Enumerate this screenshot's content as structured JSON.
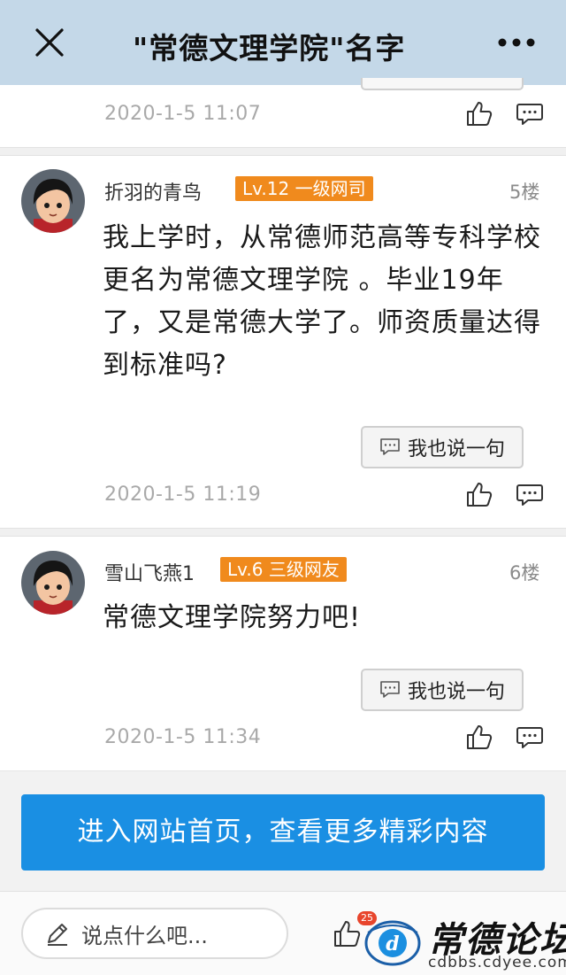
{
  "header": {
    "title": "\"常德文理学院\"名字",
    "close_icon": "close-icon",
    "more_icon": "more-icon"
  },
  "previous_post": {
    "time": "2020-1-5 11:07"
  },
  "posts": [
    {
      "username": "折羽的青鸟",
      "level": "Lv.12 一级网司",
      "floor": "5楼",
      "content": "我上学时，从常德师范高等专科学校更名为常德文理学院 。毕业19年了，又是常德大学了。师资质量达得到标准吗?",
      "reply_label": "我也说一句",
      "time": "2020-1-5 11:19"
    },
    {
      "username": "雪山飞燕1",
      "level": "Lv.6 三级网友",
      "floor": "6楼",
      "content": "常德文理学院努力吧!",
      "reply_label": "我也说一句",
      "time": "2020-1-5 11:34"
    }
  ],
  "home_button": {
    "label": "进入网站首页，查看更多精彩内容"
  },
  "bottom_bar": {
    "input_placeholder": "说点什么吧...",
    "like_count": "25",
    "watermark_title": "常德论坛",
    "watermark_url": "cdbbs.cdyee.com"
  },
  "colors": {
    "header_bg": "#c4d8e8",
    "level_badge": "#f08a1d",
    "home_button": "#1a8fe3",
    "count_badge": "#e8452c"
  }
}
